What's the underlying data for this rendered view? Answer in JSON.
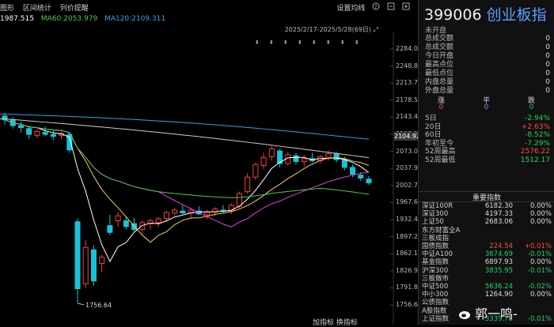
{
  "toolbar": {
    "items": [
      "图形",
      "区间统计",
      "列价提醒"
    ],
    "settings_label": "设置均线",
    "date_range": "2025/2/17-2025/5/28(69日)"
  },
  "ma": {
    "ma5": "1987.515",
    "ma60": "MA60:2053.979",
    "ma120": "MA120:2109.311"
  },
  "chart_data": {
    "type": "candlestick",
    "y_ticks": [
      "2284.04",
      "2248.88",
      "2213.72",
      "2178.56",
      "2143.40",
      "2108.24",
      "2073.08",
      "2037.92",
      "2002.76",
      "1967.60",
      "1932.44",
      "1897.28",
      "1862.12",
      "1826.96",
      "1791.80",
      "1756.64"
    ],
    "ylim": [
      1756.64,
      2284.04
    ],
    "current_price_flag": "2104.92",
    "low_label": "1756.64",
    "candles": [
      {
        "o": 2146,
        "h": 2152,
        "l": 2128,
        "c": 2138
      },
      {
        "o": 2138,
        "h": 2144,
        "l": 2120,
        "c": 2126
      },
      {
        "o": 2126,
        "h": 2134,
        "l": 2112,
        "c": 2122
      },
      {
        "o": 2120,
        "h": 2126,
        "l": 2098,
        "c": 2108
      },
      {
        "o": 2106,
        "h": 2118,
        "l": 2100,
        "c": 2114
      },
      {
        "o": 2112,
        "h": 2124,
        "l": 2104,
        "c": 2108
      },
      {
        "o": 2108,
        "h": 2116,
        "l": 2096,
        "c": 2104
      },
      {
        "o": 2106,
        "h": 2114,
        "l": 2098,
        "c": 2110
      },
      {
        "o": 2108,
        "h": 2112,
        "l": 2070,
        "c": 2076
      },
      {
        "o": 1928,
        "h": 1934,
        "l": 1760,
        "c": 1790
      },
      {
        "o": 1800,
        "h": 1890,
        "l": 1792,
        "c": 1875
      },
      {
        "o": 1870,
        "h": 1880,
        "l": 1796,
        "c": 1806
      },
      {
        "o": 1842,
        "h": 1860,
        "l": 1824,
        "c": 1855
      },
      {
        "o": 1920,
        "h": 1942,
        "l": 1900,
        "c": 1906
      },
      {
        "o": 1930,
        "h": 1948,
        "l": 1918,
        "c": 1940
      },
      {
        "o": 1930,
        "h": 1940,
        "l": 1912,
        "c": 1918
      },
      {
        "o": 1924,
        "h": 1936,
        "l": 1908,
        "c": 1912
      },
      {
        "o": 1912,
        "h": 1930,
        "l": 1900,
        "c": 1926
      },
      {
        "o": 1924,
        "h": 1934,
        "l": 1912,
        "c": 1930
      },
      {
        "o": 1926,
        "h": 1938,
        "l": 1918,
        "c": 1934
      },
      {
        "o": 1935,
        "h": 1950,
        "l": 1928,
        "c": 1947
      },
      {
        "o": 1946,
        "h": 1956,
        "l": 1940,
        "c": 1952
      },
      {
        "o": 1950,
        "h": 1962,
        "l": 1944,
        "c": 1946
      },
      {
        "o": 1946,
        "h": 1956,
        "l": 1936,
        "c": 1952
      },
      {
        "o": 1950,
        "h": 1960,
        "l": 1942,
        "c": 1944
      },
      {
        "o": 1942,
        "h": 1952,
        "l": 1934,
        "c": 1948
      },
      {
        "o": 1948,
        "h": 1958,
        "l": 1940,
        "c": 1954
      },
      {
        "o": 1952,
        "h": 1962,
        "l": 1946,
        "c": 1950
      },
      {
        "o": 1950,
        "h": 1966,
        "l": 1944,
        "c": 1962
      },
      {
        "o": 1960,
        "h": 1990,
        "l": 1956,
        "c": 1986
      },
      {
        "o": 1990,
        "h": 2028,
        "l": 1986,
        "c": 2020
      },
      {
        "o": 2020,
        "h": 2050,
        "l": 2014,
        "c": 2046
      },
      {
        "o": 2044,
        "h": 2070,
        "l": 2036,
        "c": 2060
      },
      {
        "o": 2062,
        "h": 2084,
        "l": 2054,
        "c": 2078
      },
      {
        "o": 2074,
        "h": 2078,
        "l": 2040,
        "c": 2048
      },
      {
        "o": 2048,
        "h": 2072,
        "l": 2044,
        "c": 2066
      },
      {
        "o": 2064,
        "h": 2070,
        "l": 2046,
        "c": 2052
      },
      {
        "o": 2052,
        "h": 2066,
        "l": 2042,
        "c": 2058
      },
      {
        "o": 2058,
        "h": 2070,
        "l": 2050,
        "c": 2054
      },
      {
        "o": 2054,
        "h": 2066,
        "l": 2048,
        "c": 2062
      },
      {
        "o": 2060,
        "h": 2074,
        "l": 2054,
        "c": 2068
      },
      {
        "o": 2068,
        "h": 2072,
        "l": 2050,
        "c": 2056
      },
      {
        "o": 2056,
        "h": 2062,
        "l": 2034,
        "c": 2040
      },
      {
        "o": 2040,
        "h": 2046,
        "l": 2020,
        "c": 2026
      },
      {
        "o": 2024,
        "h": 2030,
        "l": 2012,
        "c": 2018
      },
      {
        "o": 2016,
        "h": 2022,
        "l": 2004,
        "c": 2008
      }
    ]
  },
  "bottom_bar": "加指标  换指标",
  "panel": {
    "code": "399006",
    "name": "创业板指",
    "status": "未开盘",
    "stats": [
      {
        "k": "总成交额",
        "v": "0"
      },
      {
        "k": "总成交额",
        "v": "0"
      },
      {
        "k": "今日开盘",
        "v": "0"
      },
      {
        "k": "最高点位",
        "v": "0"
      },
      {
        "k": "最低点位",
        "v": "0"
      },
      {
        "k": "内盘总量",
        "v": "0"
      },
      {
        "k": "外盘总量",
        "v": "0"
      }
    ],
    "breadth": {
      "up_label": "涨",
      "flat_label": "平",
      "down_label": "跌",
      "up": "0",
      "flat": "0",
      "down": "0"
    },
    "periods": [
      {
        "k": "5日",
        "v": "-2.94%",
        "color": "green"
      },
      {
        "k": "20日",
        "v": "+2.63%",
        "color": "red"
      },
      {
        "k": "60日",
        "v": "-8.52%",
        "color": "green"
      },
      {
        "k": "年初至今",
        "v": "-7.29%",
        "color": "green"
      },
      {
        "k": "52周最高",
        "v": "2576.22",
        "color": "red"
      },
      {
        "k": "52周最低",
        "v": "1512.17",
        "color": "green"
      }
    ],
    "section_title": "重要指数",
    "indices": [
      {
        "n": "深证100R",
        "p": "6182.30",
        "c": "0.00%",
        "pc": "white",
        "cc": "white"
      },
      {
        "n": "深证300",
        "p": "4197.33",
        "c": "0.00%",
        "pc": "white",
        "cc": "white"
      },
      {
        "n": "上证50",
        "p": "2683.06",
        "c": "0.00%",
        "pc": "white",
        "cc": "white"
      },
      {
        "n": "东方财富全A",
        "p": "",
        "c": "",
        "pc": "white",
        "cc": "white"
      },
      {
        "n": "三板成指",
        "p": "",
        "c": "",
        "pc": "white",
        "cc": "white"
      },
      {
        "n": "国债指数",
        "p": "224.54",
        "c": "+0.01%",
        "pc": "red",
        "cc": "red"
      },
      {
        "n": "中证A100",
        "p": "3674.69",
        "c": "-0.01%",
        "pc": "green",
        "cc": "green"
      },
      {
        "n": "基金指数",
        "p": "6897.93",
        "c": "0.00%",
        "pc": "white",
        "cc": "white"
      },
      {
        "n": "沪深300",
        "p": "3835.95",
        "c": "-0.01%",
        "pc": "green",
        "cc": "green"
      },
      {
        "n": "三板做市",
        "p": "",
        "c": "",
        "pc": "white",
        "cc": "white"
      },
      {
        "n": "中证500",
        "p": "5636.24",
        "c": "-0.02%",
        "pc": "green",
        "cc": "green"
      },
      {
        "n": "中小300",
        "p": "1264.90",
        "c": "0.00%",
        "pc": "white",
        "cc": "white"
      },
      {
        "n": "公债指数",
        "p": "",
        "c": "",
        "pc": "white",
        "cc": "white"
      },
      {
        "n": "A股指数",
        "p": "",
        "c": "",
        "pc": "white",
        "cc": "white"
      },
      {
        "n": "上证指数",
        "p": "3339.73",
        "c": "-0.01%",
        "pc": "green",
        "cc": "green"
      }
    ]
  },
  "watermark": "郭一鸣-",
  "colors": {
    "up": "#ff3b3b",
    "down": "#18c3d9",
    "ma5": "#ffffff",
    "ma10": "#e8d44d",
    "ma20": "#e040e0",
    "ma60": "#4ec94e",
    "ma120": "#cccccc",
    "ma250": "#2aa7e0"
  }
}
